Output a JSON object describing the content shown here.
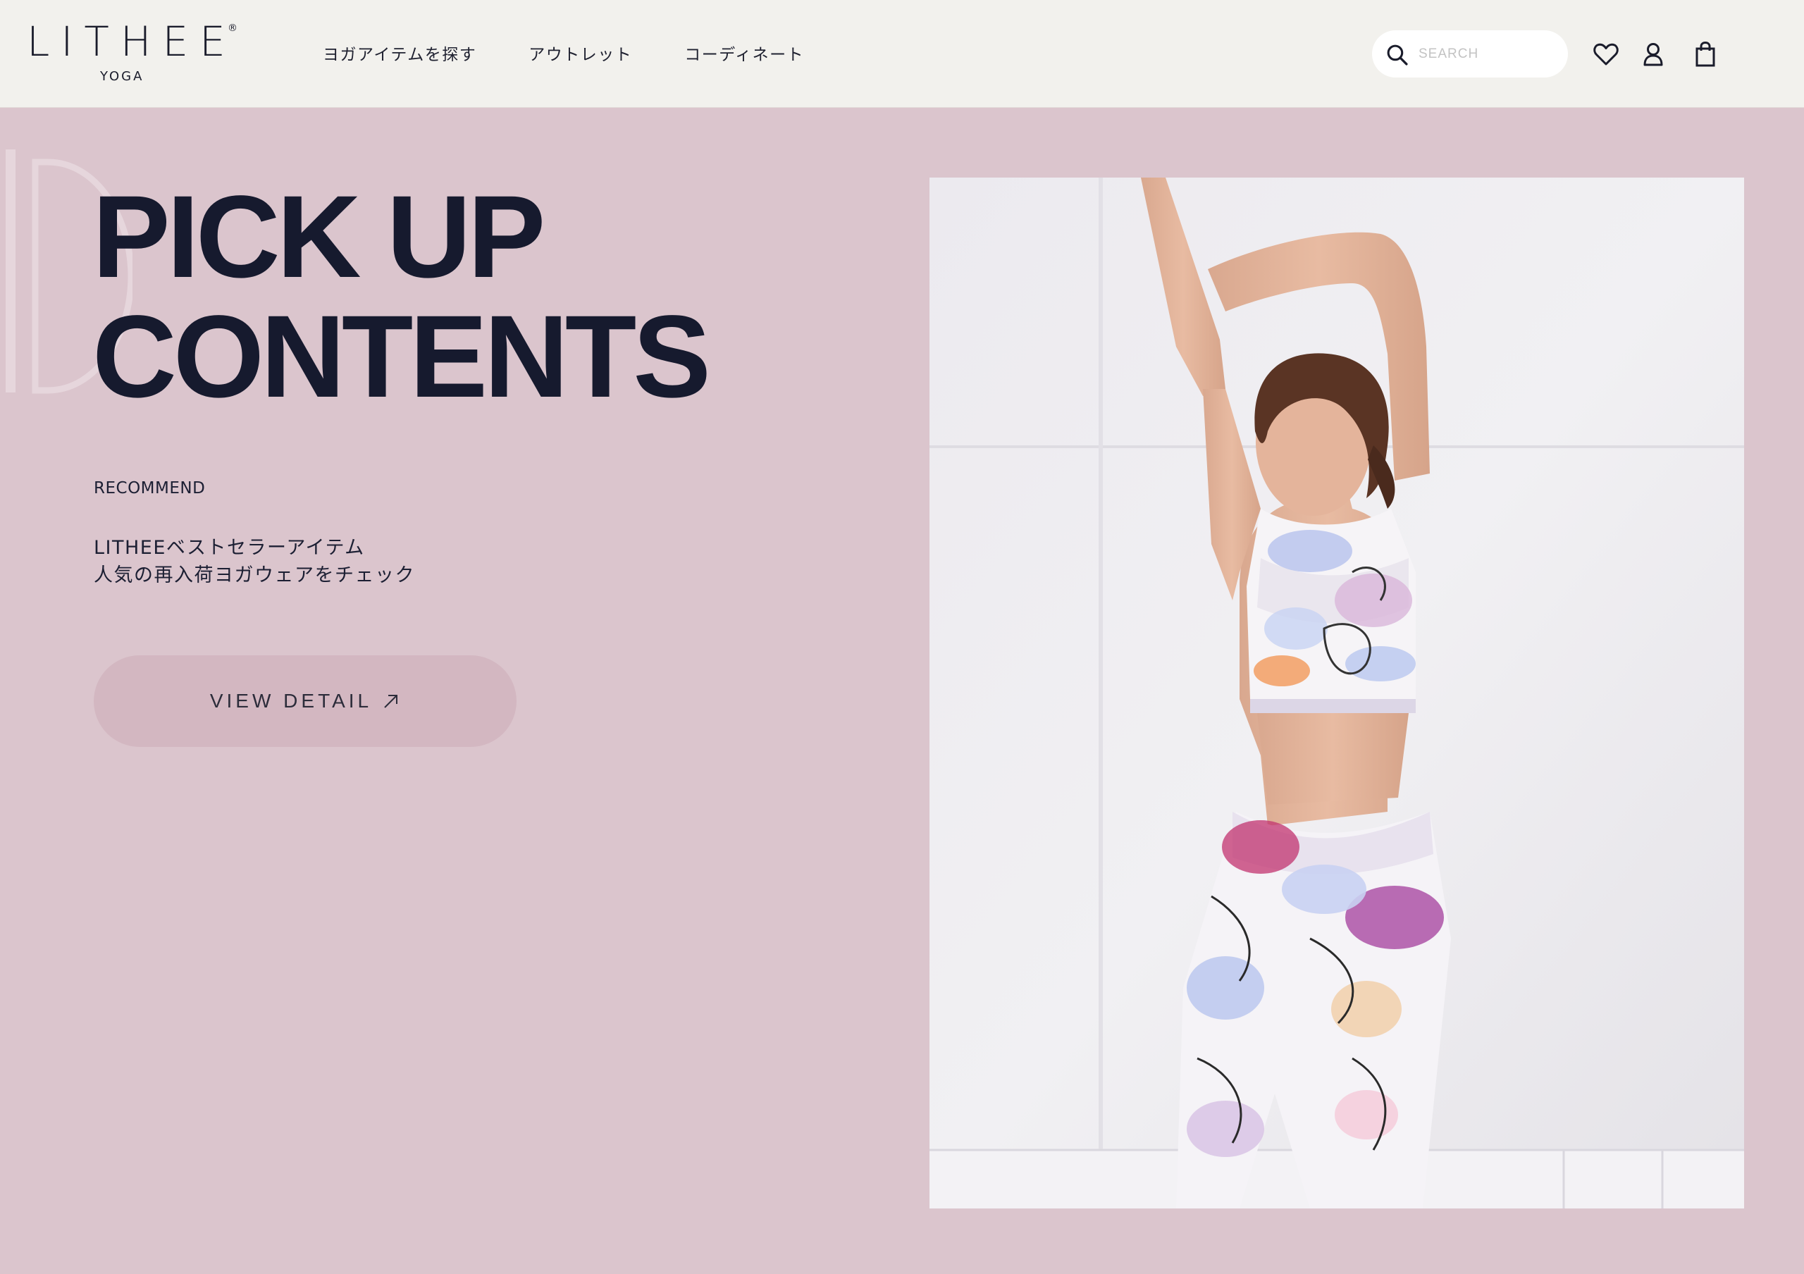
{
  "header": {
    "logo": {
      "main": "LITHEE",
      "registered": "®",
      "sub": "YOGA"
    },
    "nav": [
      {
        "label": "ヨガアイテムを探す"
      },
      {
        "label": "アウトレット"
      },
      {
        "label": "コーディネート"
      }
    ],
    "search": {
      "placeholder": "SEARCH",
      "value": ""
    },
    "icons": [
      "heart-icon",
      "user-icon",
      "shopping-bag-icon"
    ]
  },
  "hero": {
    "title_line1": "PICK UP",
    "title_line2": "CONTENTS",
    "eyebrow": "RECOMMEND",
    "description_line1": "LITHEEベストセラーアイテム",
    "description_line2": "人気の再入荷ヨガウェアをチェック",
    "cta_label": "VIEW DETAIL",
    "image_name": "model-floral-yoga-wear-photo"
  },
  "colors": {
    "page_background": "#dbc5cd",
    "header_background": "#f2f1ed",
    "text_dark": "#161a2e",
    "cta_background": "#d3b7c1"
  }
}
